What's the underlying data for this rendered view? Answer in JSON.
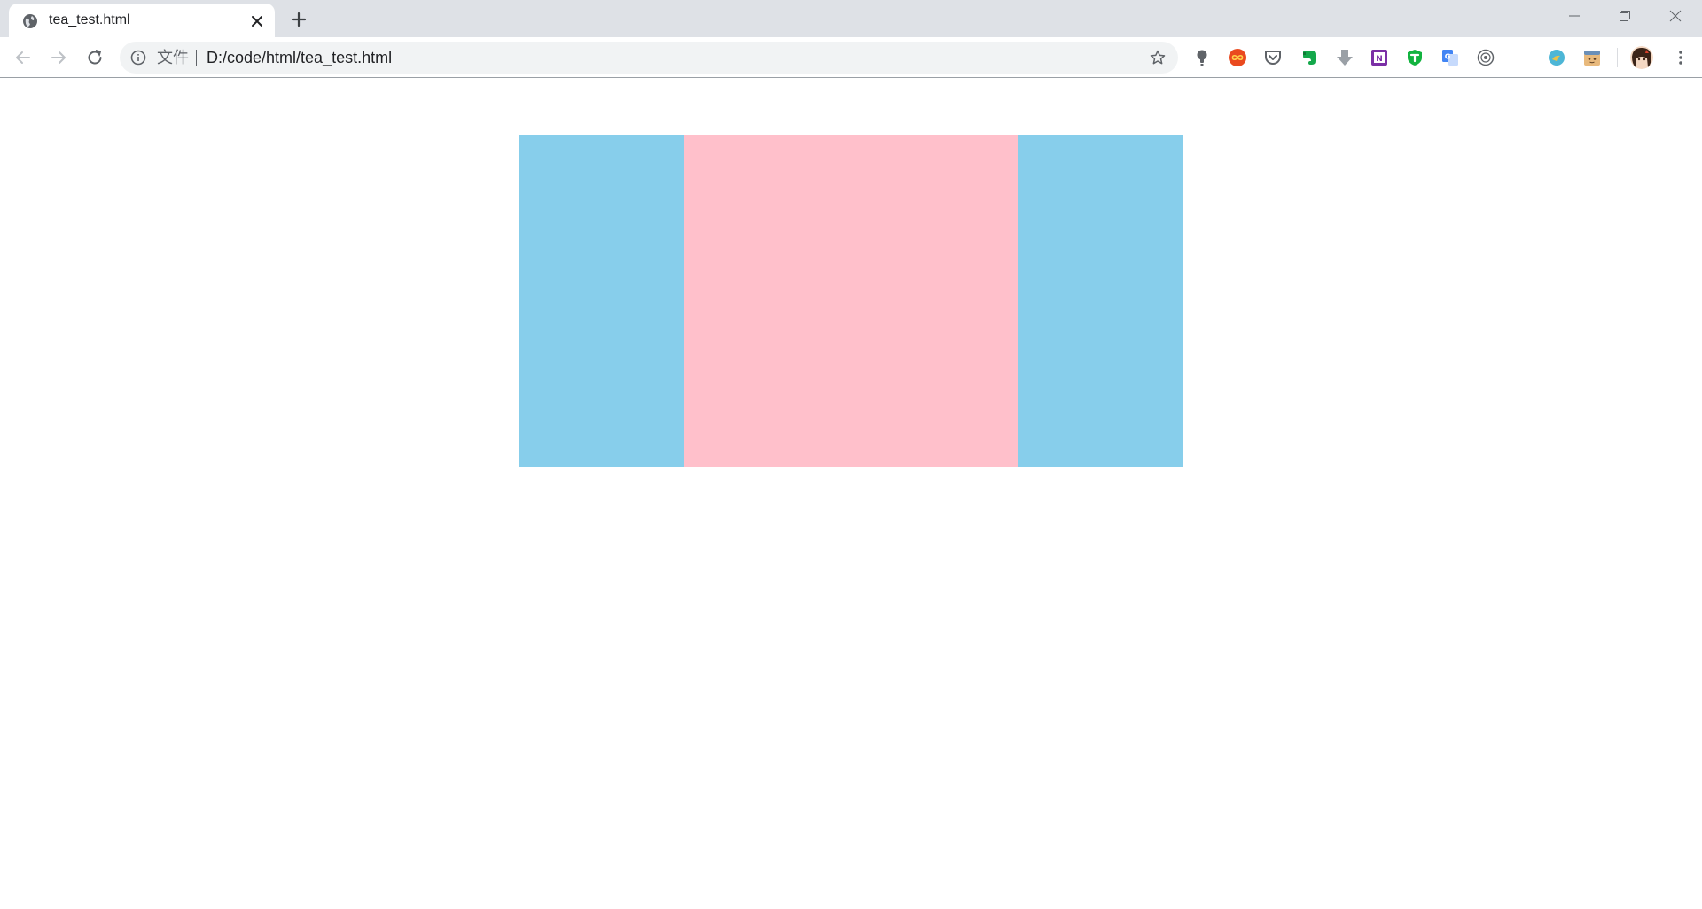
{
  "tab": {
    "title": "tea_test.html",
    "favicon": "globe-icon",
    "close_icon": "close-icon"
  },
  "new_tab_icon": "plus-icon",
  "window_controls": [
    "minimize-icon",
    "maximize-icon",
    "close-icon"
  ],
  "toolbar": {
    "back_icon": "arrow-left-icon",
    "forward_icon": "arrow-right-icon",
    "reload_icon": "reload-icon"
  },
  "omnibox": {
    "security_label": "文件",
    "url": "D:/code/html/tea_test.html",
    "info_icon": "info-icon",
    "bookmark_icon": "star-icon"
  },
  "extensions": [
    "lightbulb-icon",
    "infinity-icon",
    "pocket-icon",
    "evernote-icon",
    "download-arrow-icon",
    "onenote-icon",
    "shield-icon",
    "translate-icon",
    "target-icon",
    "globe-bird-icon",
    "face-icon"
  ],
  "menu_icon": "more-vert-icon",
  "page": {
    "layout": {
      "left_color": "#87ceeb",
      "main_color": "#ffc0cb",
      "right_color": "#87ceeb"
    }
  },
  "colors": {
    "tabstrip_bg": "#dee1e6",
    "omnibox_bg": "#f1f3f4",
    "text_primary": "#202124",
    "text_secondary": "#5f6368"
  }
}
